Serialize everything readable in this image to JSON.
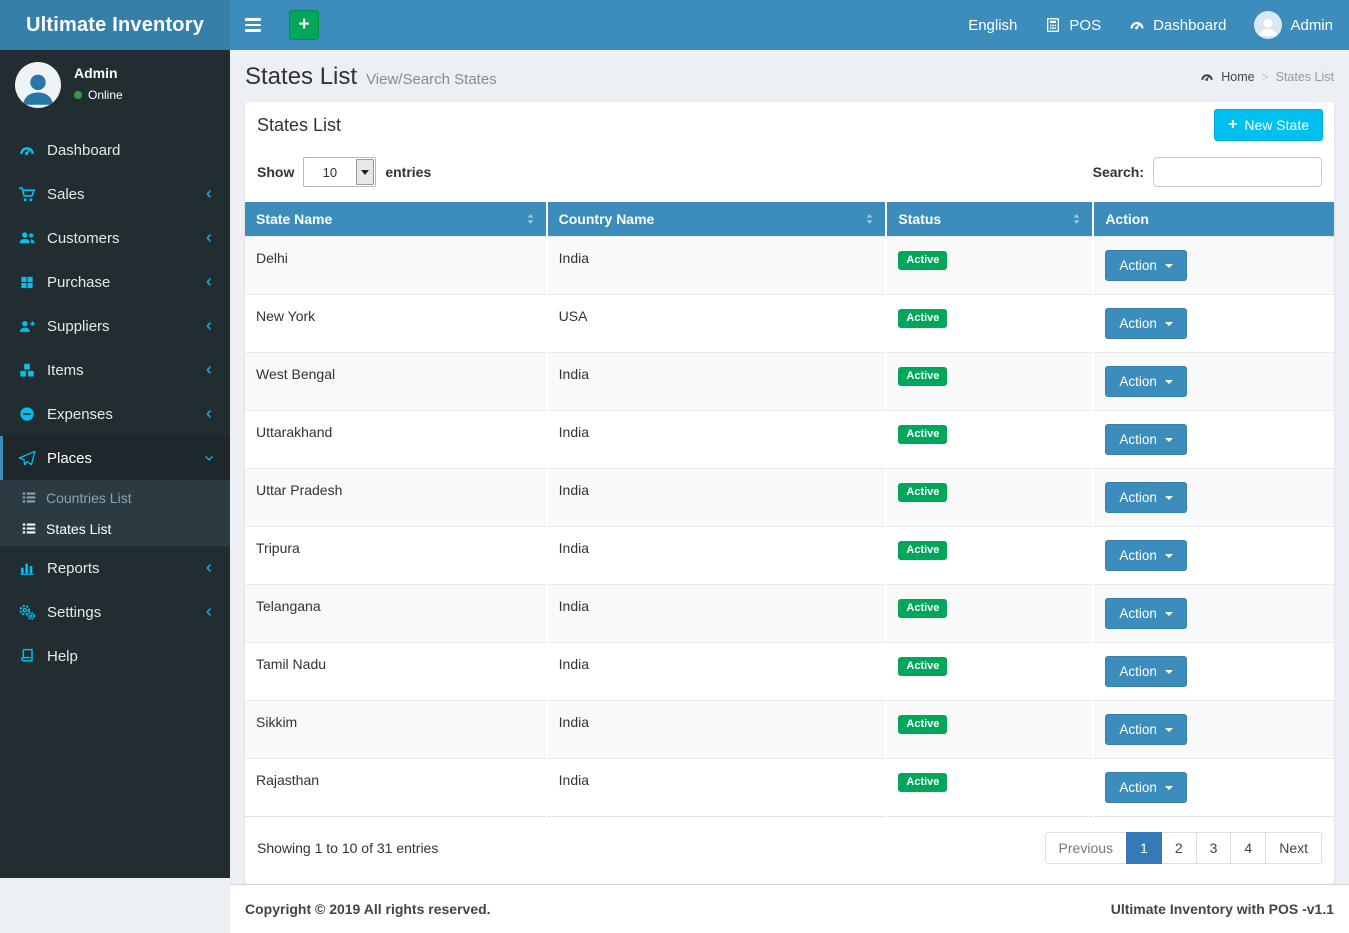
{
  "navbar": {
    "brand": "Ultimate Inventory",
    "add_label": "+",
    "right": {
      "language": "English",
      "pos": "POS",
      "dashboard": "Dashboard",
      "user": "Admin"
    }
  },
  "sidebar": {
    "user": {
      "name": "Admin",
      "status": "Online"
    },
    "items": [
      {
        "label": "Dashboard"
      },
      {
        "label": "Sales"
      },
      {
        "label": "Customers"
      },
      {
        "label": "Purchase"
      },
      {
        "label": "Suppliers"
      },
      {
        "label": "Items"
      },
      {
        "label": "Expenses"
      },
      {
        "label": "Places",
        "children": [
          {
            "label": "Countries List"
          },
          {
            "label": "States List"
          }
        ]
      },
      {
        "label": "Reports"
      },
      {
        "label": "Settings"
      },
      {
        "label": "Help"
      }
    ]
  },
  "page": {
    "title": "States List",
    "subtitle": "View/Search States",
    "breadcrumb": {
      "home": "Home",
      "separator": ">",
      "current": "States List"
    }
  },
  "panel": {
    "title": "States List",
    "new_button": "New State",
    "show_label": "Show",
    "page_length": "10",
    "entries_label": "entries",
    "search_label": "Search:",
    "search_value": ""
  },
  "table": {
    "columns": [
      "State Name",
      "Country Name",
      "Status",
      "Action"
    ],
    "action_label": "Action",
    "rows": [
      {
        "state": "Delhi",
        "country": "India",
        "status": "Active"
      },
      {
        "state": "New York",
        "country": "USA",
        "status": "Active"
      },
      {
        "state": "West Bengal",
        "country": "India",
        "status": "Active"
      },
      {
        "state": "Uttarakhand",
        "country": "India",
        "status": "Active"
      },
      {
        "state": "Uttar Pradesh",
        "country": "India",
        "status": "Active"
      },
      {
        "state": "Tripura",
        "country": "India",
        "status": "Active"
      },
      {
        "state": "Telangana",
        "country": "India",
        "status": "Active"
      },
      {
        "state": "Tamil Nadu",
        "country": "India",
        "status": "Active"
      },
      {
        "state": "Sikkim",
        "country": "India",
        "status": "Active"
      },
      {
        "state": "Rajasthan",
        "country": "India",
        "status": "Active"
      }
    ],
    "info": "Showing 1 to 10 of 31 entries",
    "pagination": {
      "previous": "Previous",
      "pages": [
        "1",
        "2",
        "3",
        "4"
      ],
      "active_page": "1",
      "next": "Next"
    }
  },
  "footer": {
    "left": "Copyright © 2019 All rights reserved.",
    "right": "Ultimate Inventory with POS -v1.1"
  },
  "colors": {
    "navbar": "#3c8dbc",
    "logo_bg": "#367fa9",
    "sidebar_bg": "#222d32",
    "sidebar_submenu_bg": "#2c3b41",
    "sidebar_icon": "#00c0ef",
    "success_badge": "#00a65a",
    "info_button": "#00c0ef",
    "table_header": "#3c8dbc",
    "pagination_active": "#337ab7",
    "content_bg": "#ecf0f5"
  }
}
